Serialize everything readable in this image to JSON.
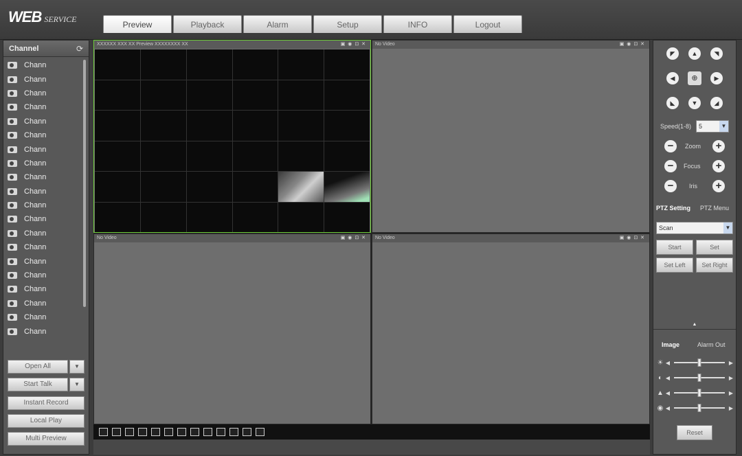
{
  "header": {
    "logo_main": "WEB",
    "logo_sub": "SERVICE",
    "tabs": [
      "Preview",
      "Playback",
      "Alarm",
      "Setup",
      "INFO",
      "Logout"
    ],
    "active_tab": "Preview"
  },
  "channel_panel": {
    "title": "Channel",
    "channels": [
      "Chann",
      "Chann",
      "Chann",
      "Chann",
      "Chann",
      "Chann",
      "Chann",
      "Chann",
      "Chann",
      "Chann",
      "Chann",
      "Chann",
      "Chann",
      "Chann",
      "Chann",
      "Chann",
      "Chann",
      "Chann",
      "Chann",
      "Chann"
    ],
    "buttons": {
      "open_all": "Open All",
      "start_talk": "Start Talk",
      "instant_record": "Instant Record",
      "local_play": "Local Play",
      "multi_preview": "Multi Preview"
    }
  },
  "video": {
    "panes": [
      {
        "label": "XXXXXX XXX XX Preview XXXXXXXX XX"
      },
      {
        "label": "No Video"
      },
      {
        "label": "No Video"
      },
      {
        "label": "No Video"
      }
    ]
  },
  "ptz": {
    "speed_label": "Speed(1-8)",
    "speed_value": "5",
    "zoom_label": "Zoom",
    "focus_label": "Focus",
    "iris_label": "Iris",
    "tab_setting": "PTZ Setting",
    "tab_menu": "PTZ Menu",
    "mode_value": "Scan",
    "btn_start": "Start",
    "btn_set": "Set",
    "btn_set_left": "Set Left",
    "btn_set_right": "Set Right"
  },
  "image_panel": {
    "tab_image": "Image",
    "tab_alarm_out": "Alarm Out",
    "sliders": [
      {
        "icon": "brightness-icon",
        "value": 0.5
      },
      {
        "icon": "contrast-icon",
        "value": 0.5
      },
      {
        "icon": "saturation-icon",
        "value": 0.5
      },
      {
        "icon": "hue-icon",
        "value": 0.5
      }
    ],
    "reset_label": "Reset"
  },
  "colors": {
    "selected_pane_border": "#6fce3a",
    "background": "#3c3c3c"
  }
}
